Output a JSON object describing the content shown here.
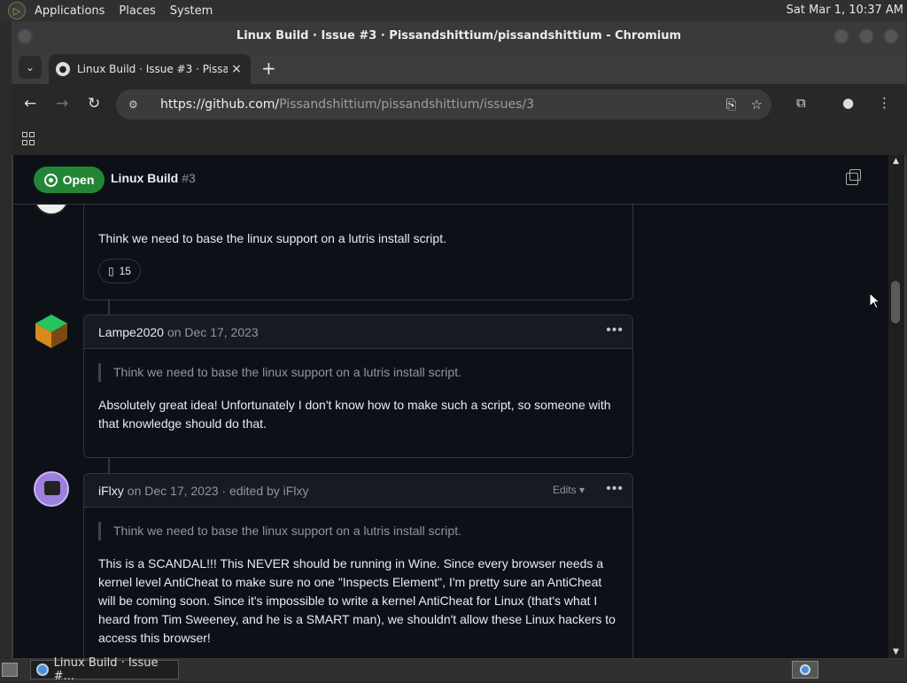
{
  "top_panel": {
    "menus": [
      "Applications",
      "Places",
      "System"
    ],
    "clock": "Sat Mar  1, 10:37 AM"
  },
  "window": {
    "title": "Linux Build · Issue #3 · Pissandshittium/pissandshittium - Chromium"
  },
  "tab": {
    "title": "Linux Build · Issue #3 · Pissandshittium",
    "close": "×",
    "new_tab": "+"
  },
  "omnibox": {
    "url_host": "https://github.com/",
    "url_path": "Pissandshittium/pissandshittium/issues/3"
  },
  "issue": {
    "state": "Open",
    "title": "Linux Build",
    "number": "#3"
  },
  "comments": [
    {
      "body": "Think we need to base the linux support on a lutris install script.",
      "reaction_count": "15"
    },
    {
      "author": "Lampe2020",
      "meta": "on Dec 17, 2023",
      "quote": "Think we need to base the linux support on a lutris install script.",
      "body": "Absolutely great idea! Unfortunately I don't know how to make such a script, so someone with that knowledge should do that."
    },
    {
      "author": "iFlxy",
      "meta": "on Dec 17, 2023 · edited by iFlxy",
      "edits_label": "Edits",
      "quote": "Think we need to base the linux support on a lutris install script.",
      "body": "This is a SCANDAL!!! This NEVER should be running in Wine. Since every browser needs a kernel level AntiCheat to make sure no one \"Inspects Element\", I'm pretty sure an AntiCheat will be coming soon. Since it's impossible to write a kernel AntiCheat for Linux (that's what I heard from Tim Sweeney, and he is a SMART man), we shouldn't allow these Linux hackers to access this browser!"
    }
  ],
  "taskbar": {
    "task_label": "Linux Build · Issue #..."
  }
}
